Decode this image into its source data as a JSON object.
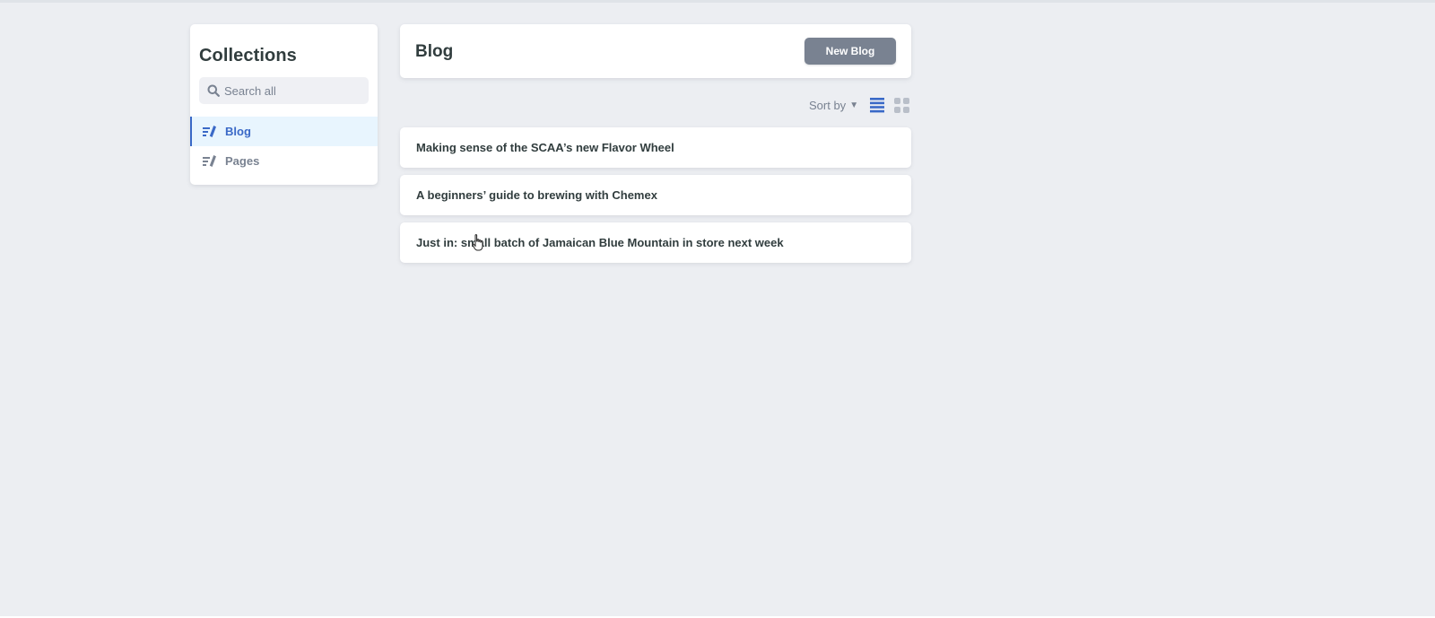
{
  "sidebar": {
    "title": "Collections",
    "search": {
      "placeholder": "Search all",
      "value": ""
    },
    "items": [
      {
        "label": "Blog",
        "icon": "write-icon",
        "active": true
      },
      {
        "label": "Pages",
        "icon": "write-icon",
        "active": false
      }
    ]
  },
  "main": {
    "title": "Blog",
    "new_button_label": "New Blog",
    "toolbar": {
      "sort_label": "Sort by",
      "view_list_icon": "list-view-icon",
      "view_grid_icon": "grid-view-icon",
      "active_view": "list"
    },
    "entries": [
      {
        "title": "Making sense of the SCAA’s new Flavor Wheel"
      },
      {
        "title": "A beginners’ guide to brewing with Chemex"
      },
      {
        "title": "Just in: small batch of Jamaican Blue Mountain in store next week"
      }
    ]
  },
  "colors": {
    "background": "#eceef2",
    "accent": "#3a69c7",
    "active_bg": "#e8f5fe",
    "button_bg": "#798291",
    "text": "#313d3e",
    "muted": "#798291"
  }
}
